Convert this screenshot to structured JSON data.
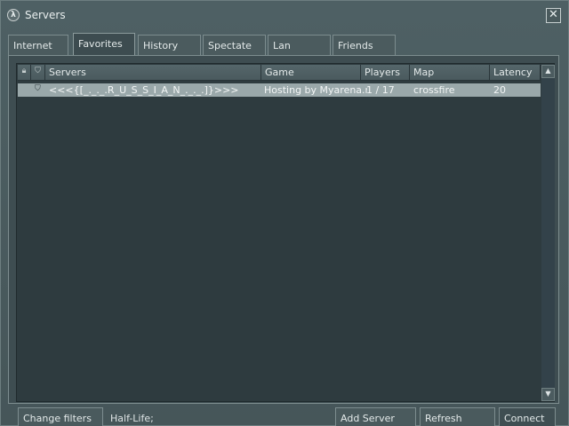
{
  "window": {
    "title": "Servers",
    "close_symbol": "✕",
    "app_icon": "half-life-lambda-icon"
  },
  "tabs": [
    {
      "label": "Internet",
      "active": false
    },
    {
      "label": "Favorites",
      "active": true
    },
    {
      "label": "History",
      "active": false
    },
    {
      "label": "Spectate",
      "active": false
    },
    {
      "label": "Lan",
      "active": false
    },
    {
      "label": "Friends",
      "active": false
    }
  ],
  "list": {
    "header_icons": [
      "lock-icon",
      "shield-icon"
    ],
    "columns": [
      "Servers",
      "Game",
      "Players",
      "Map",
      "Latency"
    ],
    "rows": [
      {
        "secure": true,
        "server": "<<<{[_._._.R_U_S_S_I_A_N_._._.]}>>>",
        "game": "Hosting by Myarena.ru",
        "players": "1 / 17",
        "map": "crossfire",
        "latency": "20"
      }
    ],
    "scroll_up": "▲",
    "scroll_down": "▼"
  },
  "bottom": {
    "change_filters": "Change filters",
    "filter_summary": "Half-Life;",
    "add_server": "Add Server",
    "refresh": "Refresh",
    "connect": "Connect"
  },
  "colors": {
    "window_bg": "#4e6064",
    "list_bg": "#2e3b3f",
    "selected_row": "#9aa8aa"
  }
}
